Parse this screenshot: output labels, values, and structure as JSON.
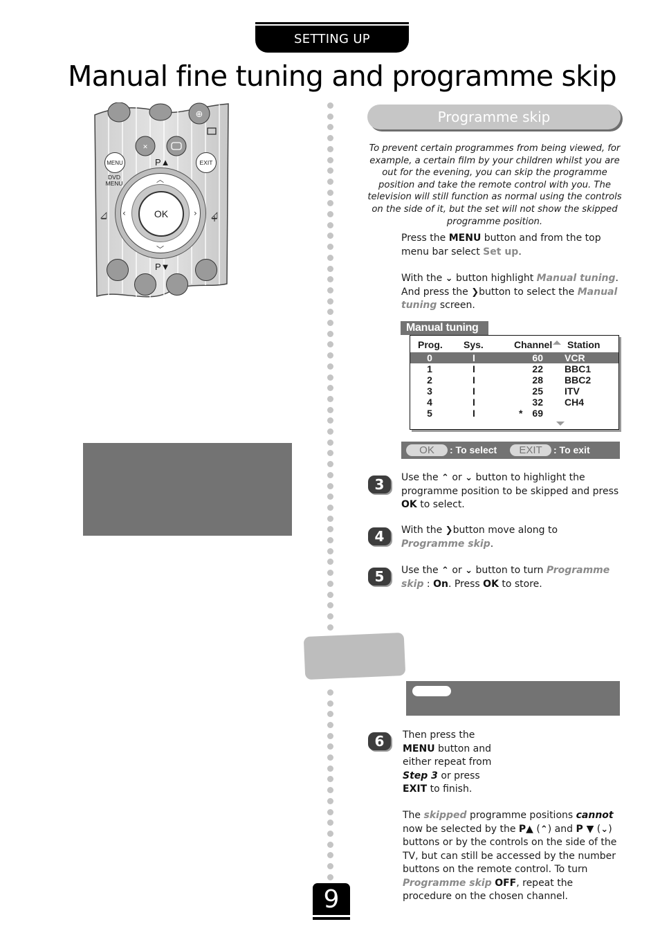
{
  "header": {
    "section_tab": "SETTING UP",
    "page_title": "Manual fine tuning and programme skip"
  },
  "remote": {
    "buttons": {
      "menu": "MENU",
      "dvd_menu": "DVD\nMENU",
      "exit": "EXIT",
      "ok": "OK",
      "p_up": "P▲",
      "p_down": "P▼",
      "nav_up": "^",
      "nav_down": "v",
      "nav_left": "<",
      "nav_right": ">"
    }
  },
  "section": {
    "title": "Programme skip",
    "intro": "To prevent certain programmes from being viewed, for example, a certain film by your children whilst you are out for the evening, you can skip the programme position and take the remote control with you. The television will still function as normal using the controls on the side of it, but the set will not show the skipped programme position."
  },
  "instructions": {
    "p1": {
      "t1": "Press the ",
      "b1": "MENU",
      "t2": " button and from the top menu bar select ",
      "h1": "Set up",
      "t3": "."
    },
    "p2": {
      "t1": "With the ",
      "g1": "⌄",
      "t2": " button highlight ",
      "h1": "Manual tuning",
      "t3": ". And press the ",
      "g2": "❯",
      "t4": "button to select the ",
      "h2": "Manual tuning",
      "t5": " screen."
    }
  },
  "menu_screen": {
    "title": "Manual tuning",
    "columns": [
      "Prog.",
      "Sys.",
      "Channel",
      "Station"
    ],
    "rows": [
      {
        "prog": "0",
        "sys": "I",
        "mark": "",
        "channel": "60",
        "station": "VCR",
        "selected": true
      },
      {
        "prog": "1",
        "sys": "I",
        "mark": "",
        "channel": "22",
        "station": "BBC1",
        "selected": false
      },
      {
        "prog": "2",
        "sys": "I",
        "mark": "",
        "channel": "28",
        "station": "BBC2",
        "selected": false
      },
      {
        "prog": "3",
        "sys": "I",
        "mark": "",
        "channel": "25",
        "station": "ITV",
        "selected": false
      },
      {
        "prog": "4",
        "sys": "I",
        "mark": "",
        "channel": "32",
        "station": "CH4",
        "selected": false
      },
      {
        "prog": "5",
        "sys": "I",
        "mark": "*",
        "channel": "69",
        "station": "",
        "selected": false
      }
    ],
    "legend": {
      "ok_key": "OK",
      "ok_label": ": To select",
      "exit_key": "EXIT",
      "exit_label": ": To exit"
    }
  },
  "steps": [
    {
      "num": "3",
      "t1": "Use the ",
      "g1": "⌃",
      "t2": " or ",
      "g2": "⌄",
      "t3": " button to highlight the programme position to be skipped and press ",
      "b1": "OK",
      "t4": " to select."
    },
    {
      "num": "4",
      "t1": "With the ",
      "g1": "❯",
      "t2": "button move along to ",
      "h1": "Programme skip",
      "t3": "."
    },
    {
      "num": "5",
      "t1": "Use the ",
      "g1": "⌃",
      "t2": " or ",
      "g2": "⌄",
      "t3": " button to turn ",
      "h1": "Programme skip",
      "t4": " : ",
      "b1": "On",
      "t5": ". Press ",
      "b2": "OK",
      "t6": " to store."
    },
    {
      "num": "6",
      "t1": "Then press the",
      "b1": "MENU",
      "t2": " button and either repeat from ",
      "bi1": "Step 3",
      "t3": " or press ",
      "b2": "EXIT",
      "t4": " to finish."
    }
  ],
  "note": {
    "t1": "The ",
    "h1": "skipped",
    "t2": " programme positions ",
    "bi1": "cannot",
    "t3": " now be selected by the ",
    "b1": "P▲",
    "t4": " (",
    "g1": "⌃",
    "t5": ") and ",
    "b2": "P ▼",
    "t6": " (",
    "g2": "⌄",
    "t7": ") buttons or by the controls on the side of the TV, but can still be accessed by the number buttons on the remote control. To turn ",
    "h2": "Programme skip",
    "t8": " ",
    "b3": "OFF",
    "t9": ", repeat the procedure on the chosen channel."
  },
  "footer": {
    "page_number": "9"
  }
}
